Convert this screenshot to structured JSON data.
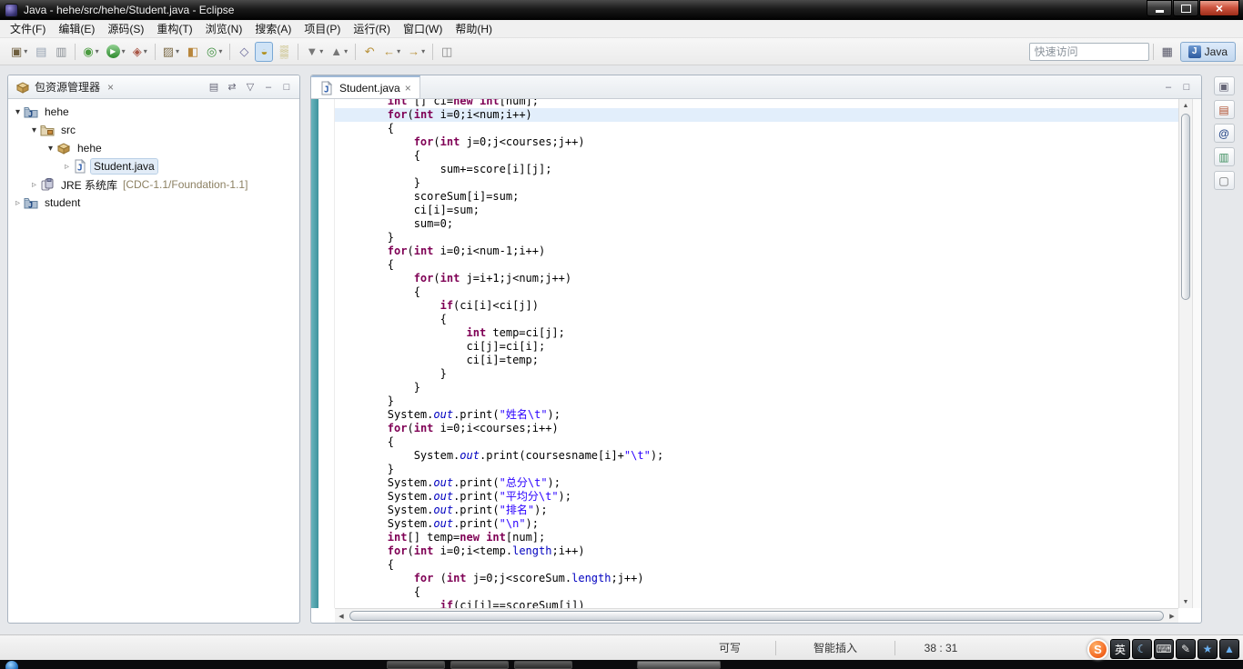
{
  "window": {
    "title": "Java - hehe/src/hehe/Student.java - Eclipse"
  },
  "menu": {
    "items": [
      "文件(F)",
      "编辑(E)",
      "源码(S)",
      "重构(T)",
      "浏览(N)",
      "搜索(A)",
      "项目(P)",
      "运行(R)",
      "窗口(W)",
      "帮助(H)"
    ]
  },
  "toolbar": {
    "quick_access_placeholder": "快速访问",
    "perspective_label": "Java",
    "open_perspective_icon": "▦",
    "buttons": [
      {
        "name": "new-wizard-button",
        "glyph": "▣",
        "color": "#6f5f3f",
        "drop": true
      },
      {
        "name": "save-button",
        "glyph": "▤",
        "color": "#97a3b2"
      },
      {
        "name": "print-button",
        "glyph": "▥",
        "color": "#8a9096"
      },
      {
        "sep": true
      },
      {
        "name": "debug-button",
        "glyph": "◉",
        "color": "#4a9b3f",
        "drop": true
      },
      {
        "name": "run-button",
        "glyph": "▶",
        "shape": "circle",
        "drop": true
      },
      {
        "name": "external-tools-button",
        "glyph": "◈",
        "color": "#a85545",
        "drop": true
      },
      {
        "sep": true
      },
      {
        "name": "new-java-project-button",
        "glyph": "▨",
        "color": "#7d6c49",
        "drop": true
      },
      {
        "name": "new-package-button",
        "glyph": "◧",
        "color": "#b8863b"
      },
      {
        "name": "new-class-button",
        "glyph": "◎",
        "color": "#3f8f3f",
        "drop": true
      },
      {
        "sep": true
      },
      {
        "name": "open-type-button",
        "glyph": "◇",
        "color": "#6a6a9a"
      },
      {
        "name": "search-button",
        "glyph": "◒",
        "color": "#b09020",
        "pressed": true
      },
      {
        "name": "mark-occurrences-button",
        "glyph": "▒",
        "color": "#b0a040"
      },
      {
        "sep": true
      },
      {
        "name": "next-annotation-button",
        "glyph": "▼",
        "color": "#777777",
        "drop": true
      },
      {
        "name": "previous-annotation-button",
        "glyph": "▲",
        "color": "#777777",
        "drop": true
      },
      {
        "sep": true
      },
      {
        "name": "last-edit-location-button",
        "glyph": "↶",
        "color": "#b8913a"
      },
      {
        "name": "back-button",
        "glyph": "←",
        "color": "#b8913a",
        "drop": true
      },
      {
        "name": "forward-button",
        "glyph": "→",
        "color": "#b8913a",
        "drop": true
      },
      {
        "sep": true
      },
      {
        "name": "pin-editor-button",
        "glyph": "◫",
        "color": "#888888"
      }
    ]
  },
  "package_explorer": {
    "title": "包资源管理器",
    "actions": [
      {
        "name": "collapse-all-button",
        "glyph": "▤"
      },
      {
        "name": "link-with-editor-button",
        "glyph": "⇄"
      },
      {
        "name": "view-menu-button",
        "glyph": "▽"
      },
      {
        "name": "minimize-view-button",
        "glyph": "–"
      },
      {
        "name": "maximize-view-button",
        "glyph": "□"
      }
    ],
    "items": [
      {
        "label": "hehe",
        "level": 0,
        "expanded": true,
        "icon": "java-project",
        "selected": false
      },
      {
        "label": "src",
        "level": 1,
        "expanded": true,
        "icon": "source-folder",
        "selected": false
      },
      {
        "label": "hehe",
        "level": 2,
        "expanded": true,
        "icon": "package",
        "selected": false
      },
      {
        "label": "Student.java",
        "level": 3,
        "expanded": false,
        "icon": "java-file",
        "selected": true
      },
      {
        "label": "JRE 系统库",
        "suffix": "[CDC-1.1/Foundation-1.1]",
        "level": 1,
        "expanded": false,
        "icon": "library",
        "selected": false
      },
      {
        "label": "student",
        "level": 0,
        "expanded": false,
        "icon": "java-project",
        "selected": false
      }
    ]
  },
  "editor": {
    "tab_title": "Student.java",
    "current_line_index": 1,
    "actions": [
      {
        "name": "minimize-editor-button",
        "glyph": "–"
      },
      {
        "name": "maximize-editor-button",
        "glyph": "□"
      }
    ],
    "syntax": {
      "keywords": [
        "for",
        "if",
        "int",
        "new"
      ],
      "static_fields": [
        "out"
      ],
      "fields": [
        "length"
      ]
    },
    "lines": [
      "        int [] ci=new int[num];",
      "        for(int i=0;i<num;i++)",
      "        {",
      "            for(int j=0;j<courses;j++)",
      "            {",
      "                sum+=score[i][j];",
      "            }",
      "            scoreSum[i]=sum;",
      "            ci[i]=sum;",
      "            sum=0;",
      "        }",
      "        for(int i=0;i<num-1;i++)",
      "        {",
      "            for(int j=i+1;j<num;j++)",
      "            {",
      "                if(ci[i]<ci[j])",
      "                {",
      "                    int temp=ci[j];",
      "                    ci[j]=ci[i];",
      "                    ci[i]=temp;",
      "                }",
      "            }",
      "        }",
      "        System.out.print(\"姓名\\t\");",
      "        for(int i=0;i<courses;i++)",
      "        {",
      "            System.out.print(coursesname[i]+\"\\t\");",
      "        }",
      "        System.out.print(\"总分\\t\");",
      "        System.out.print(\"平均分\\t\");",
      "        System.out.print(\"排名\");",
      "        System.out.print(\"\\n\");",
      "        int[] temp=new int[num];",
      "        for(int i=0;i<temp.length;i++)",
      "        {",
      "            for (int j=0;j<scoreSum.length;j++)",
      "            {",
      "                if(ci[i]==scoreSum[j])"
    ]
  },
  "right_trim": {
    "icons": [
      {
        "name": "restore-views-button",
        "glyph": "▣",
        "color": "#666677"
      },
      {
        "name": "task-list-view-button",
        "glyph": "▤",
        "color": "#b05030"
      },
      {
        "name": "javadoc-view-button",
        "glyph": "@",
        "color": "#2a4a8a"
      },
      {
        "name": "outline-view-button",
        "glyph": "▥",
        "color": "#3f8f5f"
      },
      {
        "name": "templates-view-button",
        "glyph": "▢",
        "color": "#666666"
      }
    ]
  },
  "status_bar": {
    "writable": "可写",
    "input_mode": "智能插入",
    "caret_position": "38 : 31"
  },
  "ime": {
    "icons": [
      {
        "name": "sogou-logo",
        "glyph": "S",
        "type": "logo"
      },
      {
        "name": "ime-language-english",
        "glyph": "英",
        "color": "#ffffff"
      },
      {
        "name": "ime-fullwidth-moon-icon",
        "glyph": "☾",
        "color": "#9fd4ff"
      },
      {
        "name": "ime-soft-keyboard-icon",
        "glyph": "⌨",
        "color": "#e8e8e8"
      },
      {
        "name": "ime-handwriting-icon",
        "glyph": "✎",
        "color": "#e8e8e8"
      },
      {
        "name": "ime-toolbox-icon",
        "glyph": "★",
        "color": "#6ab0f0"
      },
      {
        "name": "ime-expand-icon",
        "glyph": "▲",
        "color": "#6ab0f0"
      }
    ]
  }
}
